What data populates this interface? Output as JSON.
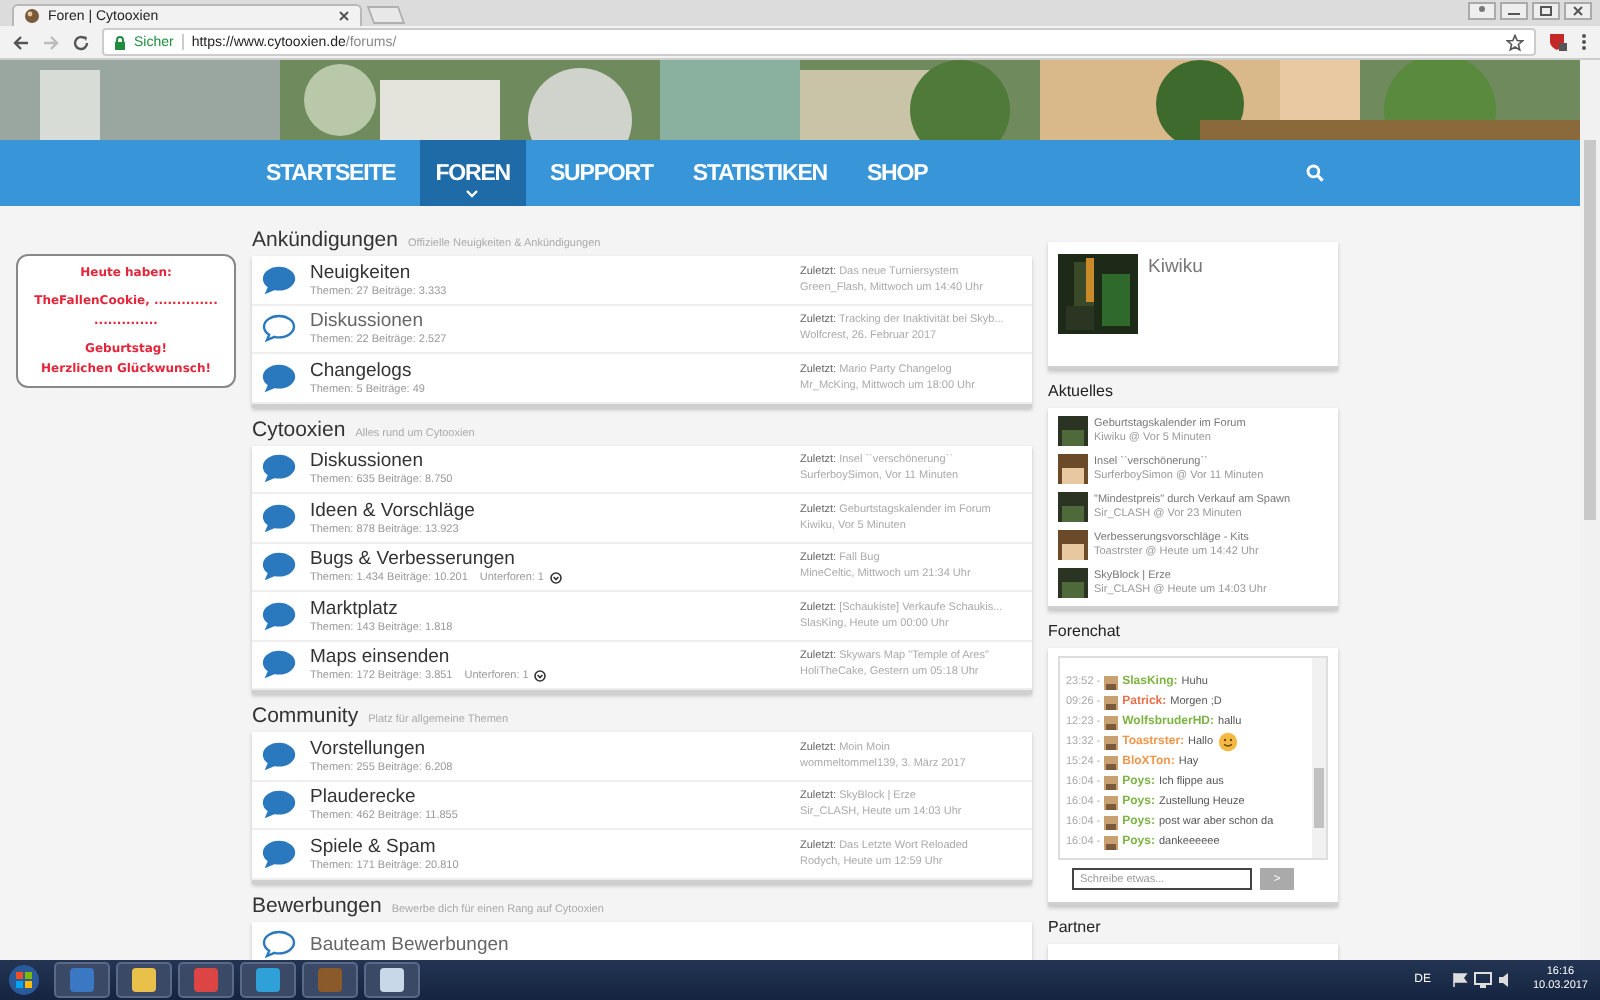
{
  "browser": {
    "tab_title": "Foren | Cytooxien",
    "security_label": "Sicher",
    "url_host": "https://www.cytooxien.de",
    "url_path": "/forums/"
  },
  "nav": [
    {
      "label": "STARTSEITE",
      "selected": false
    },
    {
      "label": "FOREN",
      "selected": true
    },
    {
      "label": "SUPPORT",
      "selected": false
    },
    {
      "label": "STATISTIKEN",
      "selected": false
    },
    {
      "label": "SHOP",
      "selected": false
    }
  ],
  "birthday": {
    "paragraphs": [
      [
        "Heute haben:"
      ],
      [
        "TheFallenCookie, ..............",
        ".............."
      ],
      [
        "Geburtstag!",
        "Herzlichen Glückwunsch!"
      ]
    ]
  },
  "categories": [
    {
      "title": "Ankündigungen",
      "subtitle": "Offizielle Neuigkeiten & Ankündigungen",
      "forums": [
        {
          "name": "Neuigkeiten",
          "unread": true,
          "stats": "Themen: 27 Beiträge: 3.333",
          "last": "**Zuletzt:** Das neue Turniersystem",
          "last_meta": "Green_Flash, Mittwoch um 14:40 Uhr"
        },
        {
          "name": "Diskussionen",
          "unread": false,
          "stats": "Themen: 22 Beiträge: 2.527",
          "last": "**Zuletzt:** Tracking der Inaktivität bei Skyb...",
          "last_meta": "Wolfcrest, 26. Februar 2017"
        },
        {
          "name": "Changelogs",
          "unread": true,
          "stats": "Themen: 5 Beiträge: 49",
          "last": "**Zuletzt:** Mario Party Changelog",
          "last_meta": "Mr_McKing, Mittwoch um 18:00 Uhr"
        }
      ]
    },
    {
      "title": "Cytooxien",
      "subtitle": "Alles rund um Cytooxien",
      "forums": [
        {
          "name": "Diskussionen",
          "unread": true,
          "stats": "Themen: 635 Beiträge: 8.750",
          "last": "**Zuletzt:** Insel ``verschönerung``",
          "last_meta": "SurferboySimon, Vor 11 Minuten"
        },
        {
          "name": "Ideen & Vorschläge",
          "unread": true,
          "stats": "Themen: 878 Beiträge: 13.923",
          "last": "**Zuletzt:** Geburtstagskalender im Forum",
          "last_meta": "Kiwiku, Vor 5 Minuten"
        },
        {
          "name": "Bugs & Verbesserungen",
          "unread": true,
          "stats": "Themen: 1.434 Beiträge: 10.201",
          "subforums": "Unterforen: 1",
          "last": "**Zuletzt:** Fall Bug",
          "last_meta": "MineCeltic, Mittwoch um 21:34 Uhr"
        },
        {
          "name": "Marktplatz",
          "unread": true,
          "stats": "Themen: 143 Beiträge: 1.818",
          "last": "**Zuletzt:** [Schaukiste] Verkaufe Schaukis...",
          "last_meta": "SlasKing, Heute um 00:00 Uhr"
        },
        {
          "name": "Maps einsenden",
          "unread": true,
          "stats": "Themen: 172 Beiträge: 3.851",
          "subforums": "Unterforen: 1",
          "last": "**Zuletzt:** Skywars Map \"Temple of Ares\"",
          "last_meta": "HoliTheCake, Gestern um 05:18 Uhr"
        }
      ]
    },
    {
      "title": "Community",
      "subtitle": "Platz für allgemeine Themen",
      "forums": [
        {
          "name": "Vorstellungen",
          "unread": true,
          "stats": "Themen: 255 Beiträge: 6.208",
          "last": "**Zuletzt:** Moin Moin",
          "last_meta": "wommeltommel139, 3. März 2017"
        },
        {
          "name": "Plauderecke",
          "unread": true,
          "stats": "Themen: 462 Beiträge: 11.855",
          "last": "**Zuletzt:** SkyBlock | Erze",
          "last_meta": "Sir_CLASH, Heute um 14:03 Uhr"
        },
        {
          "name": "Spiele & Spam",
          "unread": true,
          "stats": "Themen: 171 Beiträge: 20.810",
          "last": "**Zuletzt:** Das Letzte Wort Reloaded",
          "last_meta": "Rodych, Heute um 12:59 Uhr"
        }
      ]
    },
    {
      "title": "Bewerbungen",
      "subtitle": "Bewerbe dich für einen Rang auf Cytooxien",
      "forums": [
        {
          "name": "Bauteam Bewerbungen",
          "unread": false
        }
      ]
    }
  ],
  "profile": {
    "name": "Kiwiku"
  },
  "news": {
    "title": "Aktuelles",
    "items": [
      {
        "title": "Geburtstagskalender im Forum",
        "meta": "Kiwiku @ Vor 5 Minuten"
      },
      {
        "title": "Insel ``verschönerung``",
        "meta": "SurferboySimon @ Vor 11 Minuten"
      },
      {
        "title": "\"Mindestpreis\" durch Verkauf am Spawn",
        "meta": "Sir_CLASH @ Vor 23 Minuten"
      },
      {
        "title": "Verbesserungsvorschläge - Kits",
        "meta": "Toastrster @ Heute um 14:42 Uhr"
      },
      {
        "title": "SkyBlock | Erze",
        "meta": "Sir_CLASH @ Heute um 14:03 Uhr"
      }
    ]
  },
  "chat": {
    "title": "Forenchat",
    "messages": [
      {
        "time": "23:52 -",
        "user": "SlasKing:",
        "color": "#7cb342",
        "text": "Huhu",
        "emoji": false
      },
      {
        "time": "09:26 -",
        "user": "Patrick:",
        "color": "#e8704a",
        "text": "Morgen ;D",
        "emoji": false
      },
      {
        "time": "12:23 -",
        "user": "WolfsbruderHD:",
        "color": "#7cb342",
        "text": "hallu",
        "emoji": false
      },
      {
        "time": "13:32 -",
        "user": "Toastrster:",
        "color": "#f0964a",
        "text": "Hallo",
        "emoji": true
      },
      {
        "time": "15:24 -",
        "user": "BloXTon:",
        "color": "#f0964a",
        "text": "Hay",
        "emoji": false
      },
      {
        "time": "16:04 -",
        "user": "Poys:",
        "color": "#7cb342",
        "text": "Ich flippe aus",
        "emoji": false
      },
      {
        "time": "16:04 -",
        "user": "Poys:",
        "color": "#7cb342",
        "text": "Zustellung Heuze",
        "emoji": false
      },
      {
        "time": "16:04 -",
        "user": "Poys:",
        "color": "#7cb342",
        "text": "post war aber schon da",
        "emoji": false
      },
      {
        "time": "16:04 -",
        "user": "Poys:",
        "color": "#7cb342",
        "text": "dankeeeeee",
        "emoji": false
      }
    ],
    "placeholder": "Schreibe etwas...",
    "send": ">"
  },
  "partner": {
    "title": "Partner"
  },
  "taskbar": {
    "language": "DE",
    "time": "16:16",
    "date": "10.03.2017"
  }
}
